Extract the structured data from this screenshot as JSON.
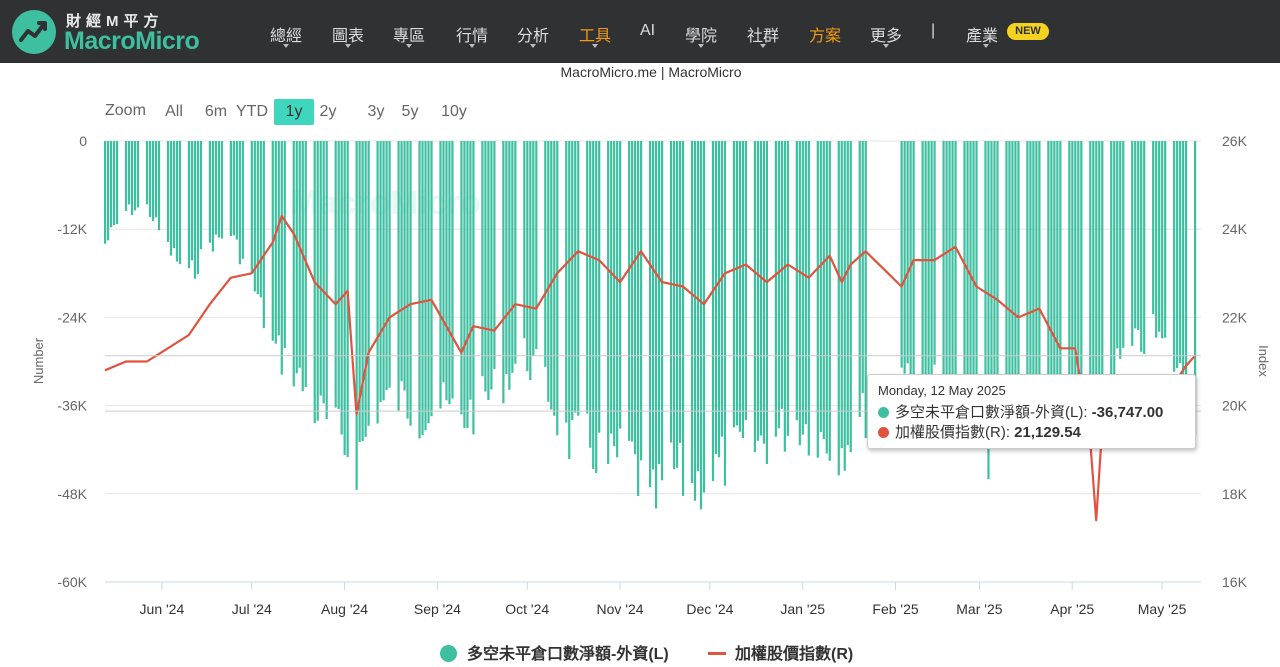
{
  "brand": {
    "name_cn": "財經M平方",
    "name_en": "MacroMicro",
    "color": "#3dbfa0"
  },
  "nav": {
    "items": [
      {
        "label": "總經",
        "highlight": false,
        "caret": true
      },
      {
        "label": "圖表",
        "highlight": false,
        "caret": true
      },
      {
        "label": "專區",
        "highlight": false,
        "caret": true
      },
      {
        "label": "行情",
        "highlight": false,
        "caret": true
      },
      {
        "label": "分析",
        "highlight": false,
        "caret": true
      },
      {
        "label": "工具",
        "highlight": true,
        "caret": true
      },
      {
        "label": "AI",
        "highlight": false,
        "caret": false
      },
      {
        "label": "學院",
        "highlight": false,
        "caret": true
      },
      {
        "label": "社群",
        "highlight": false,
        "caret": true
      },
      {
        "label": "方案",
        "highlight": true,
        "caret": false
      },
      {
        "label": "更多",
        "highlight": false,
        "caret": true
      }
    ],
    "separator": "|",
    "industry_label": "產業",
    "new_badge": "NEW"
  },
  "source_text": "MacroMicro.me | MacroMicro",
  "zoom": {
    "label": "Zoom",
    "buttons": [
      "All",
      "6m",
      "YTD",
      "1y",
      "2y",
      "3y",
      "5y",
      "10y"
    ],
    "active": "1y"
  },
  "tooltip": {
    "date": "Monday, 12 May 2025",
    "series1_label": "多空未平倉口數淨額-外資(L): ",
    "series1_value": "-36,747.00",
    "series2_label": "加權股價指數(R): ",
    "series2_value": "21,129.54"
  },
  "legend": [
    {
      "label": "多空未平倉口數淨額-外資(L)",
      "color": "#3dbfa0"
    },
    {
      "label": "加權股價指數(R)",
      "color": "#e0533f"
    }
  ],
  "chart_data": {
    "type": "bar+line",
    "watermark": "MacroMicro",
    "left_axis": {
      "title": "Number",
      "range": [
        -60000,
        0
      ],
      "ticks": [
        0,
        -12000,
        -24000,
        -36000,
        -48000,
        -60000
      ],
      "tick_labels": [
        "0",
        "-12K",
        "-24K",
        "-36K",
        "-48K",
        "-60K"
      ]
    },
    "right_axis": {
      "title": "Index",
      "range": [
        16000,
        26000
      ],
      "ticks": [
        26000,
        24000,
        22000,
        20000,
        18000,
        16000
      ],
      "tick_labels": [
        "26K",
        "24K",
        "22K",
        "20K",
        "18K",
        "16K"
      ]
    },
    "x_axis": {
      "start": "2024-05-13",
      "end": "2025-05-14",
      "ticks": [
        {
          "date": "2024-06-01",
          "label": "Jun '24"
        },
        {
          "date": "2024-07-01",
          "label": "Jul '24"
        },
        {
          "date": "2024-08-01",
          "label": "Aug '24"
        },
        {
          "date": "2024-09-01",
          "label": "Sep '24"
        },
        {
          "date": "2024-10-01",
          "label": "Oct '24"
        },
        {
          "date": "2024-11-01",
          "label": "Nov '24"
        },
        {
          "date": "2024-12-01",
          "label": "Dec '24"
        },
        {
          "date": "2025-01-01",
          "label": "Jan '25"
        },
        {
          "date": "2025-02-01",
          "label": "Feb '25"
        },
        {
          "date": "2025-03-01",
          "label": "Mar '25"
        },
        {
          "date": "2025-04-01",
          "label": "Apr '25"
        },
        {
          "date": "2025-05-01",
          "label": "May '25"
        }
      ]
    },
    "gap": [
      "2025-01-22",
      "2025-02-03"
    ],
    "series": [
      {
        "name": "多空未平倉口數淨額-外資(L)",
        "type": "bar",
        "axis": "left",
        "color": "#3dbfa0",
        "points": [
          [
            "2024-05-13",
            -14000
          ],
          [
            "2024-05-20",
            -9500
          ],
          [
            "2024-05-27",
            -9000
          ],
          [
            "2024-06-03",
            -14500
          ],
          [
            "2024-06-10",
            -18500
          ],
          [
            "2024-06-17",
            -14000
          ],
          [
            "2024-06-24",
            -12500
          ],
          [
            "2024-07-01",
            -19000
          ],
          [
            "2024-07-08",
            -28000
          ],
          [
            "2024-07-15",
            -31000
          ],
          [
            "2024-07-22",
            -36500
          ],
          [
            "2024-07-29",
            -39500
          ],
          [
            "2024-08-05",
            -43500
          ],
          [
            "2024-08-12",
            -36000
          ],
          [
            "2024-08-19",
            -35000
          ],
          [
            "2024-08-26",
            -37000
          ],
          [
            "2024-09-02",
            -36000
          ],
          [
            "2024-09-09",
            -38000
          ],
          [
            "2024-09-16",
            -35500
          ],
          [
            "2024-09-23",
            -32500
          ],
          [
            "2024-09-30",
            -29000
          ],
          [
            "2024-10-07",
            -33000
          ],
          [
            "2024-10-14",
            -40500
          ],
          [
            "2024-10-21",
            -41000
          ],
          [
            "2024-10-28",
            -44000
          ],
          [
            "2024-11-04",
            -42000
          ],
          [
            "2024-11-11",
            -50500
          ],
          [
            "2024-11-18",
            -44500
          ],
          [
            "2024-11-25",
            -47000
          ],
          [
            "2024-12-02",
            -45000
          ],
          [
            "2024-12-09",
            -42500
          ],
          [
            "2024-12-16",
            -41500
          ],
          [
            "2024-12-23",
            -40000
          ],
          [
            "2024-12-30",
            -38000
          ],
          [
            "2025-01-06",
            -40000
          ],
          [
            "2025-01-13",
            -42000
          ],
          [
            "2025-01-20",
            -38000
          ],
          [
            "2025-02-03",
            -30500
          ],
          [
            "2025-02-10",
            -32000
          ],
          [
            "2025-02-17",
            -34500
          ],
          [
            "2025-02-24",
            -37500
          ],
          [
            "2025-03-03",
            -42500
          ],
          [
            "2025-03-10",
            -40000
          ],
          [
            "2025-03-17",
            -38000
          ],
          [
            "2025-03-24",
            -35500
          ],
          [
            "2025-03-31",
            -35000
          ],
          [
            "2025-04-07",
            -39000
          ],
          [
            "2025-04-14",
            -31500
          ],
          [
            "2025-04-21",
            -28500
          ],
          [
            "2025-04-28",
            -26000
          ],
          [
            "2025-05-05",
            -30000
          ],
          [
            "2025-05-12",
            -36747
          ]
        ]
      },
      {
        "name": "加權股價指數(R)",
        "type": "line",
        "axis": "right",
        "color": "#e0533f",
        "points": [
          [
            "2024-05-13",
            20800
          ],
          [
            "2024-05-20",
            21000
          ],
          [
            "2024-05-27",
            21000
          ],
          [
            "2024-06-03",
            21300
          ],
          [
            "2024-06-10",
            21600
          ],
          [
            "2024-06-17",
            22300
          ],
          [
            "2024-06-24",
            22900
          ],
          [
            "2024-07-01",
            23000
          ],
          [
            "2024-07-08",
            23700
          ],
          [
            "2024-07-11",
            24300
          ],
          [
            "2024-07-15",
            23900
          ],
          [
            "2024-07-22",
            22800
          ],
          [
            "2024-07-29",
            22300
          ],
          [
            "2024-08-02",
            22600
          ],
          [
            "2024-08-05",
            19800
          ],
          [
            "2024-08-09",
            21200
          ],
          [
            "2024-08-16",
            22000
          ],
          [
            "2024-08-23",
            22300
          ],
          [
            "2024-08-30",
            22400
          ],
          [
            "2024-09-04",
            21800
          ],
          [
            "2024-09-09",
            21200
          ],
          [
            "2024-09-13",
            21800
          ],
          [
            "2024-09-20",
            21700
          ],
          [
            "2024-09-27",
            22300
          ],
          [
            "2024-10-04",
            22200
          ],
          [
            "2024-10-11",
            23000
          ],
          [
            "2024-10-18",
            23500
          ],
          [
            "2024-10-25",
            23300
          ],
          [
            "2024-11-01",
            22800
          ],
          [
            "2024-11-08",
            23500
          ],
          [
            "2024-11-15",
            22800
          ],
          [
            "2024-11-22",
            22700
          ],
          [
            "2024-11-29",
            22300
          ],
          [
            "2024-12-06",
            23000
          ],
          [
            "2024-12-13",
            23200
          ],
          [
            "2024-12-20",
            22800
          ],
          [
            "2024-12-27",
            23200
          ],
          [
            "2025-01-03",
            22900
          ],
          [
            "2025-01-10",
            23400
          ],
          [
            "2025-01-14",
            22800
          ],
          [
            "2025-01-17",
            23200
          ],
          [
            "2025-01-22",
            23500
          ],
          [
            "2025-02-03",
            22700
          ],
          [
            "2025-02-07",
            23300
          ],
          [
            "2025-02-14",
            23300
          ],
          [
            "2025-02-21",
            23600
          ],
          [
            "2025-02-28",
            22700
          ],
          [
            "2025-03-07",
            22400
          ],
          [
            "2025-03-14",
            22000
          ],
          [
            "2025-03-21",
            22200
          ],
          [
            "2025-03-28",
            21300
          ],
          [
            "2025-04-02",
            21300
          ],
          [
            "2025-04-07",
            19200
          ],
          [
            "2025-04-09",
            17400
          ],
          [
            "2025-04-11",
            19500
          ],
          [
            "2025-04-18",
            19200
          ],
          [
            "2025-04-25",
            20000
          ],
          [
            "2025-05-02",
            20200
          ],
          [
            "2025-05-09",
            20900
          ],
          [
            "2025-05-12",
            21129.54
          ]
        ]
      }
    ],
    "crosshair_date": "2025-05-12"
  }
}
